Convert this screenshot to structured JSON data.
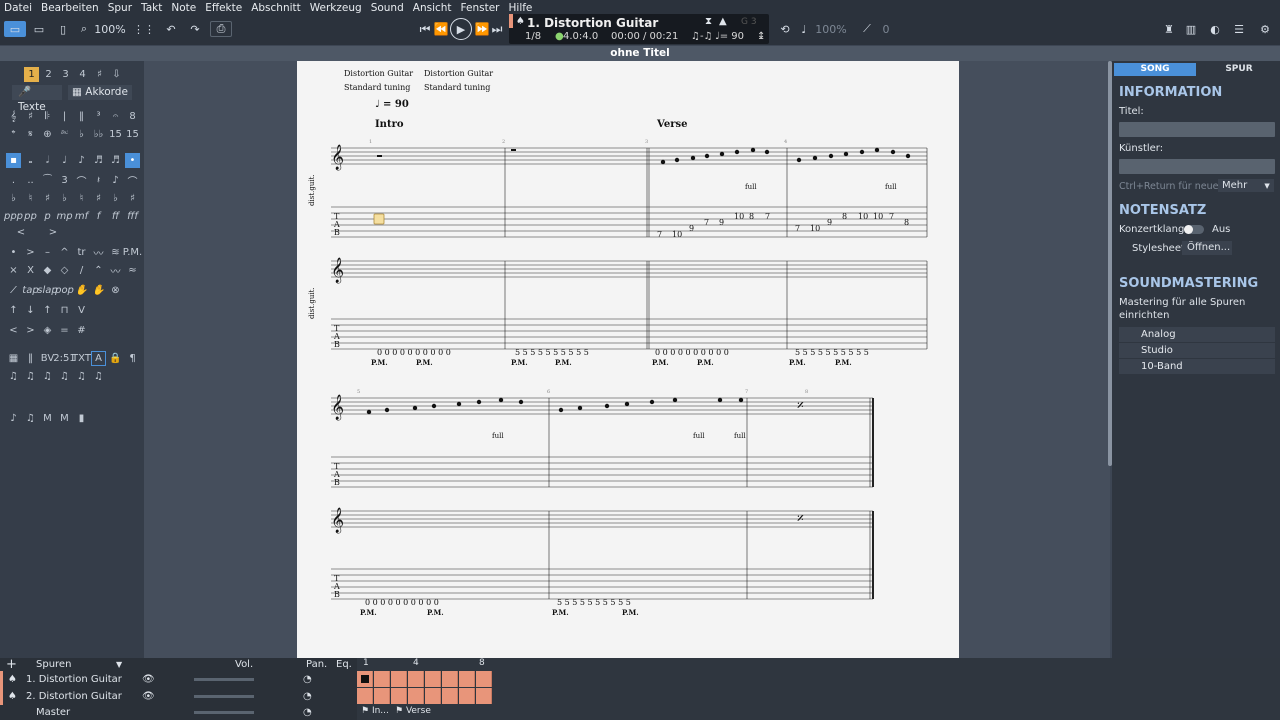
{
  "menu": [
    "Datei",
    "Bearbeiten",
    "Spur",
    "Takt",
    "Note",
    "Effekte",
    "Abschnitt",
    "Werkzeug",
    "Sound",
    "Ansicht",
    "Fenster",
    "Hilfe"
  ],
  "toolbar": {
    "zoom": "100%",
    "speed": "100%",
    "pitch": "0"
  },
  "lcd": {
    "track": "1. Distortion Guitar",
    "bar": "1/8",
    "signature": "4.0:4.0",
    "time": "00:00 / 00:21",
    "tempo": "♩= 90",
    "key": "G 3"
  },
  "doc_title": "ohne Titel",
  "palette": {
    "texte": "Texte",
    "akkorde": "Akkorde",
    "voices": [
      "1",
      "2",
      "3",
      "4"
    ]
  },
  "score": {
    "header1": "Distortion Guitar",
    "tuning1": "Standard tuning",
    "header2": "Distortion Guitar",
    "tuning2": "Standard tuning",
    "tempo": "= 90",
    "section1": "Intro",
    "section2": "Verse",
    "track_label": "dist.guit.",
    "pm": "P.M.",
    "full": "full",
    "tab_row1_t1": [
      "7",
      "10",
      "9",
      "7",
      "9",
      "10",
      "8",
      "7"
    ],
    "tab_row1_t1b": [
      "7",
      "10",
      "9",
      "8",
      "10",
      "10",
      "7",
      "8"
    ],
    "tab_row1_t2a": "0 0 0 0 0   0 0 0 0 0",
    "tab_row1_t2b": "5 5 5 5 5   5 5 5 5 5",
    "tab_row1_t2c": "0 0 0 0 0   0 0 0 0 0",
    "tab_row1_t2d": "5 5 5 5 5   5 5 5 5 5",
    "bar_numbers": [
      "1",
      "2",
      "3",
      "4",
      "5",
      "6",
      "7",
      "8"
    ],
    "clef_letters": [
      "T",
      "A",
      "B"
    ]
  },
  "right": {
    "tab_song": "SONG",
    "tab_spur": "SPUR",
    "information": "INFORMATION",
    "titel": "Titel:",
    "kuenstler": "Künstler:",
    "hint": "Ctrl+Return für neue...",
    "mehr": "Mehr",
    "notensatz": "NOTENSATZ",
    "konzertklang": "Konzertklang:",
    "aus": "Aus",
    "stylesheet": "Stylesheet:",
    "oeffnen": "Öffnen...",
    "soundmastering": "SOUNDMASTERING",
    "mastering_text1": "Mastering für alle Spuren",
    "mastering_text2": "einrichten",
    "presets": [
      "Analog",
      "Studio",
      "10-Band"
    ]
  },
  "tracks": {
    "header": "Spuren",
    "vol": "Vol.",
    "pan": "Pan.",
    "eq": "Eq.",
    "rows": [
      "1. Distortion Guitar",
      "2. Distortion Guitar"
    ],
    "master": "Master",
    "ruler": [
      "1",
      "4",
      "8"
    ],
    "markers": [
      "In...",
      "Verse"
    ]
  },
  "colors": {
    "accent": "#4a90d9",
    "clip": "#e8957a",
    "panel": "#2f3640"
  }
}
